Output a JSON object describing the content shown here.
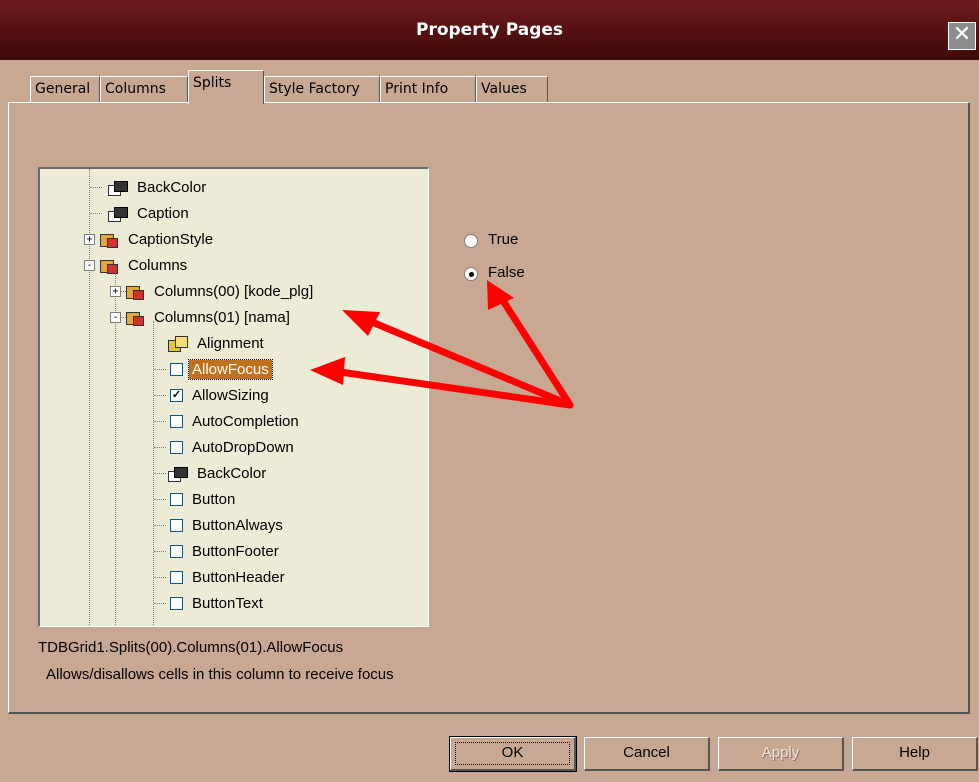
{
  "window": {
    "title": "Property Pages"
  },
  "tabs": [
    {
      "label": "General"
    },
    {
      "label": "Columns"
    },
    {
      "label": "Splits",
      "active": true
    },
    {
      "label": "Style Factory"
    },
    {
      "label": "Print Info"
    },
    {
      "label": "Values"
    }
  ],
  "tree": {
    "items": [
      {
        "label": "BackColor",
        "icon": "property-page-icon"
      },
      {
        "label": "Caption",
        "icon": "property-page-icon"
      },
      {
        "label": "CaptionStyle",
        "icon": "style-icon",
        "expander": "+"
      },
      {
        "label": "Columns",
        "icon": "style-icon",
        "expander": "-"
      },
      {
        "label": "Columns(00) [kode_plg]",
        "icon": "style-icon",
        "expander": "+"
      },
      {
        "label": "Columns(01) [nama]",
        "icon": "style-icon",
        "expander": "-"
      },
      {
        "label": "Alignment",
        "icon": "enum-icon"
      },
      {
        "label": "AllowFocus",
        "checkbox": false,
        "selected": true
      },
      {
        "label": "AllowSizing",
        "checkbox": true
      },
      {
        "label": "AutoCompletion",
        "checkbox": false
      },
      {
        "label": "AutoDropDown",
        "checkbox": false
      },
      {
        "label": "BackColor",
        "icon": "property-page-icon"
      },
      {
        "label": "Button",
        "checkbox": false
      },
      {
        "label": "ButtonAlways",
        "checkbox": false
      },
      {
        "label": "ButtonFooter",
        "checkbox": false
      },
      {
        "label": "ButtonHeader",
        "checkbox": false
      },
      {
        "label": "ButtonText",
        "checkbox": false
      }
    ]
  },
  "options": {
    "true_label": "True",
    "false_label": "False",
    "selected": "False"
  },
  "info": {
    "path": "TDBGrid1.Splits(00).Columns(01).AllowFocus",
    "description": "Allows/disallows cells in this column to receive focus"
  },
  "buttons": {
    "ok": "OK",
    "cancel": "Cancel",
    "apply": "Apply",
    "help": "Help"
  },
  "colors": {
    "dialog_bg": "#c9a893",
    "titlebar": "#501010",
    "tree_bg": "#ecebd5",
    "selection": "#c0711f",
    "annotation_arrow": "#ff0000"
  }
}
